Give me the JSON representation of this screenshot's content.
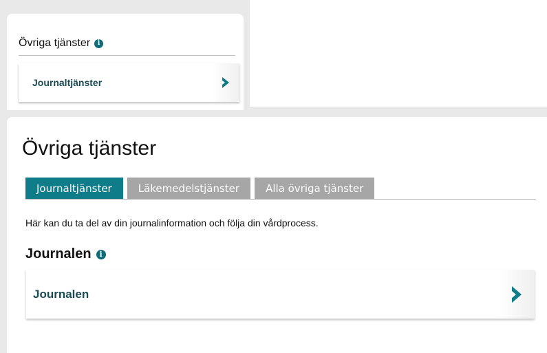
{
  "small_card": {
    "heading": "Övriga tjänster",
    "info_icon": "i",
    "link_label": "Journaltjänster",
    "chevron_icon": "chevron-right-icon"
  },
  "main": {
    "title": "Övriga tjänster",
    "tabs": [
      {
        "label": "Journaltjänster",
        "active": true
      },
      {
        "label": "Läkemedelstjänster",
        "active": false
      },
      {
        "label": "Alla övriga tjänster",
        "active": false
      }
    ],
    "intro": "Här kan du ta del av din journalinformation och följa din vårdprocess.",
    "section_heading": "Journalen",
    "info_icon": "i",
    "link_label": "Journalen"
  },
  "colors": {
    "accent": "#0f7d89",
    "tab_inactive": "#a6a6a6",
    "link_text": "#1a4a52"
  }
}
